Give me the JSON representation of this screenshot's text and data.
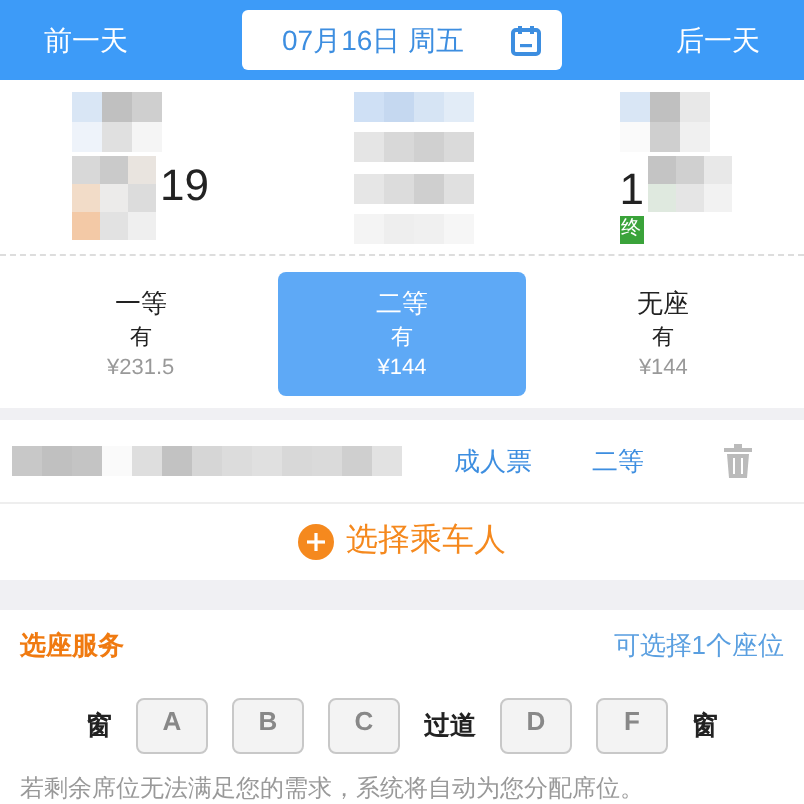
{
  "header": {
    "prev_day": "前一天",
    "date": "07月16日 周五",
    "next_day": "后一天"
  },
  "train": {
    "depart_time_fragment": "19",
    "arrive_time_fragment": "1",
    "arrive_badge": "终"
  },
  "seat_classes": [
    {
      "name": "一等",
      "availability": "有",
      "price": "¥231.5",
      "selected": false
    },
    {
      "name": "二等",
      "availability": "有",
      "price": "¥144",
      "selected": true
    },
    {
      "name": "无座",
      "availability": "有",
      "price": "¥144",
      "selected": false
    }
  ],
  "passengers": [
    {
      "ticket_type": "成人票",
      "seat_class": "二等"
    }
  ],
  "add_passenger": "选择乘车人",
  "seat_service": {
    "title": "选座服务",
    "hint": "可选择1个座位",
    "seats": [
      {
        "kind": "label",
        "text": "窗"
      },
      {
        "kind": "seat",
        "text": "A",
        "selected": false
      },
      {
        "kind": "seat",
        "text": "B",
        "selected": false
      },
      {
        "kind": "seat",
        "text": "C",
        "selected": false
      },
      {
        "kind": "label",
        "text": "过道"
      },
      {
        "kind": "seat",
        "text": "D",
        "selected": false
      },
      {
        "kind": "seat",
        "text": "F",
        "selected": false
      },
      {
        "kind": "label",
        "text": "窗"
      }
    ],
    "note": "若剩余席位无法满足您的需求，系统将自动为您分配席位。"
  }
}
